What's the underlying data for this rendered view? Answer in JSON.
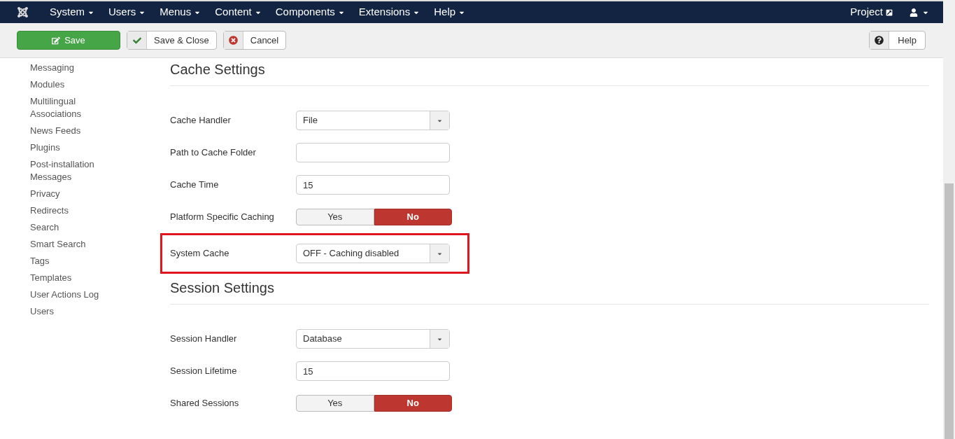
{
  "navbar": {
    "menus": [
      {
        "label": "System"
      },
      {
        "label": "Users"
      },
      {
        "label": "Menus"
      },
      {
        "label": "Content"
      },
      {
        "label": "Components"
      },
      {
        "label": "Extensions"
      },
      {
        "label": "Help"
      }
    ],
    "project_link": "Project"
  },
  "toolbar": {
    "buttons": [
      {
        "kind": "primary",
        "label": "Save"
      },
      {
        "kind": "check",
        "label": "Save & Close"
      },
      {
        "kind": "cancel",
        "label": "Cancel"
      }
    ],
    "help": "Help"
  },
  "sidebar": {
    "items": [
      "Messaging",
      "Modules",
      "Multilingual Associations",
      "News Feeds",
      "Plugins",
      "Post-installation Messages",
      "Privacy",
      "Redirects",
      "Search",
      "Smart Search",
      "Tags",
      "Templates",
      "User Actions Log",
      "Users"
    ]
  },
  "sections": [
    {
      "title": "Cache Settings",
      "fields": [
        {
          "label": "Cache Handler",
          "kind": "select",
          "value": "File",
          "highlighted": false
        },
        {
          "label": "Path to Cache Folder",
          "kind": "text",
          "highlighted": false
        },
        {
          "label": "Cache Time",
          "kind": "text",
          "value": "15",
          "highlighted": false
        },
        {
          "label": "Platform Specific Caching",
          "kind": "toggle",
          "options": [
            {
              "label": "Yes",
              "selected": false
            },
            {
              "label": "No",
              "selected": true
            }
          ],
          "highlighted": false
        },
        {
          "label": "System Cache",
          "kind": "select",
          "value": "OFF - Caching disabled",
          "highlighted": true
        }
      ]
    },
    {
      "title": "Session Settings",
      "fields": [
        {
          "label": "Session Handler",
          "kind": "select",
          "value": "Database",
          "highlighted": false
        },
        {
          "label": "Session Lifetime",
          "kind": "text",
          "value": "15",
          "highlighted": false
        },
        {
          "label": "Shared Sessions",
          "kind": "toggle",
          "options": [
            {
              "label": "Yes",
              "selected": false
            },
            {
              "label": "No",
              "selected": true
            }
          ],
          "highlighted": false
        }
      ]
    }
  ]
}
